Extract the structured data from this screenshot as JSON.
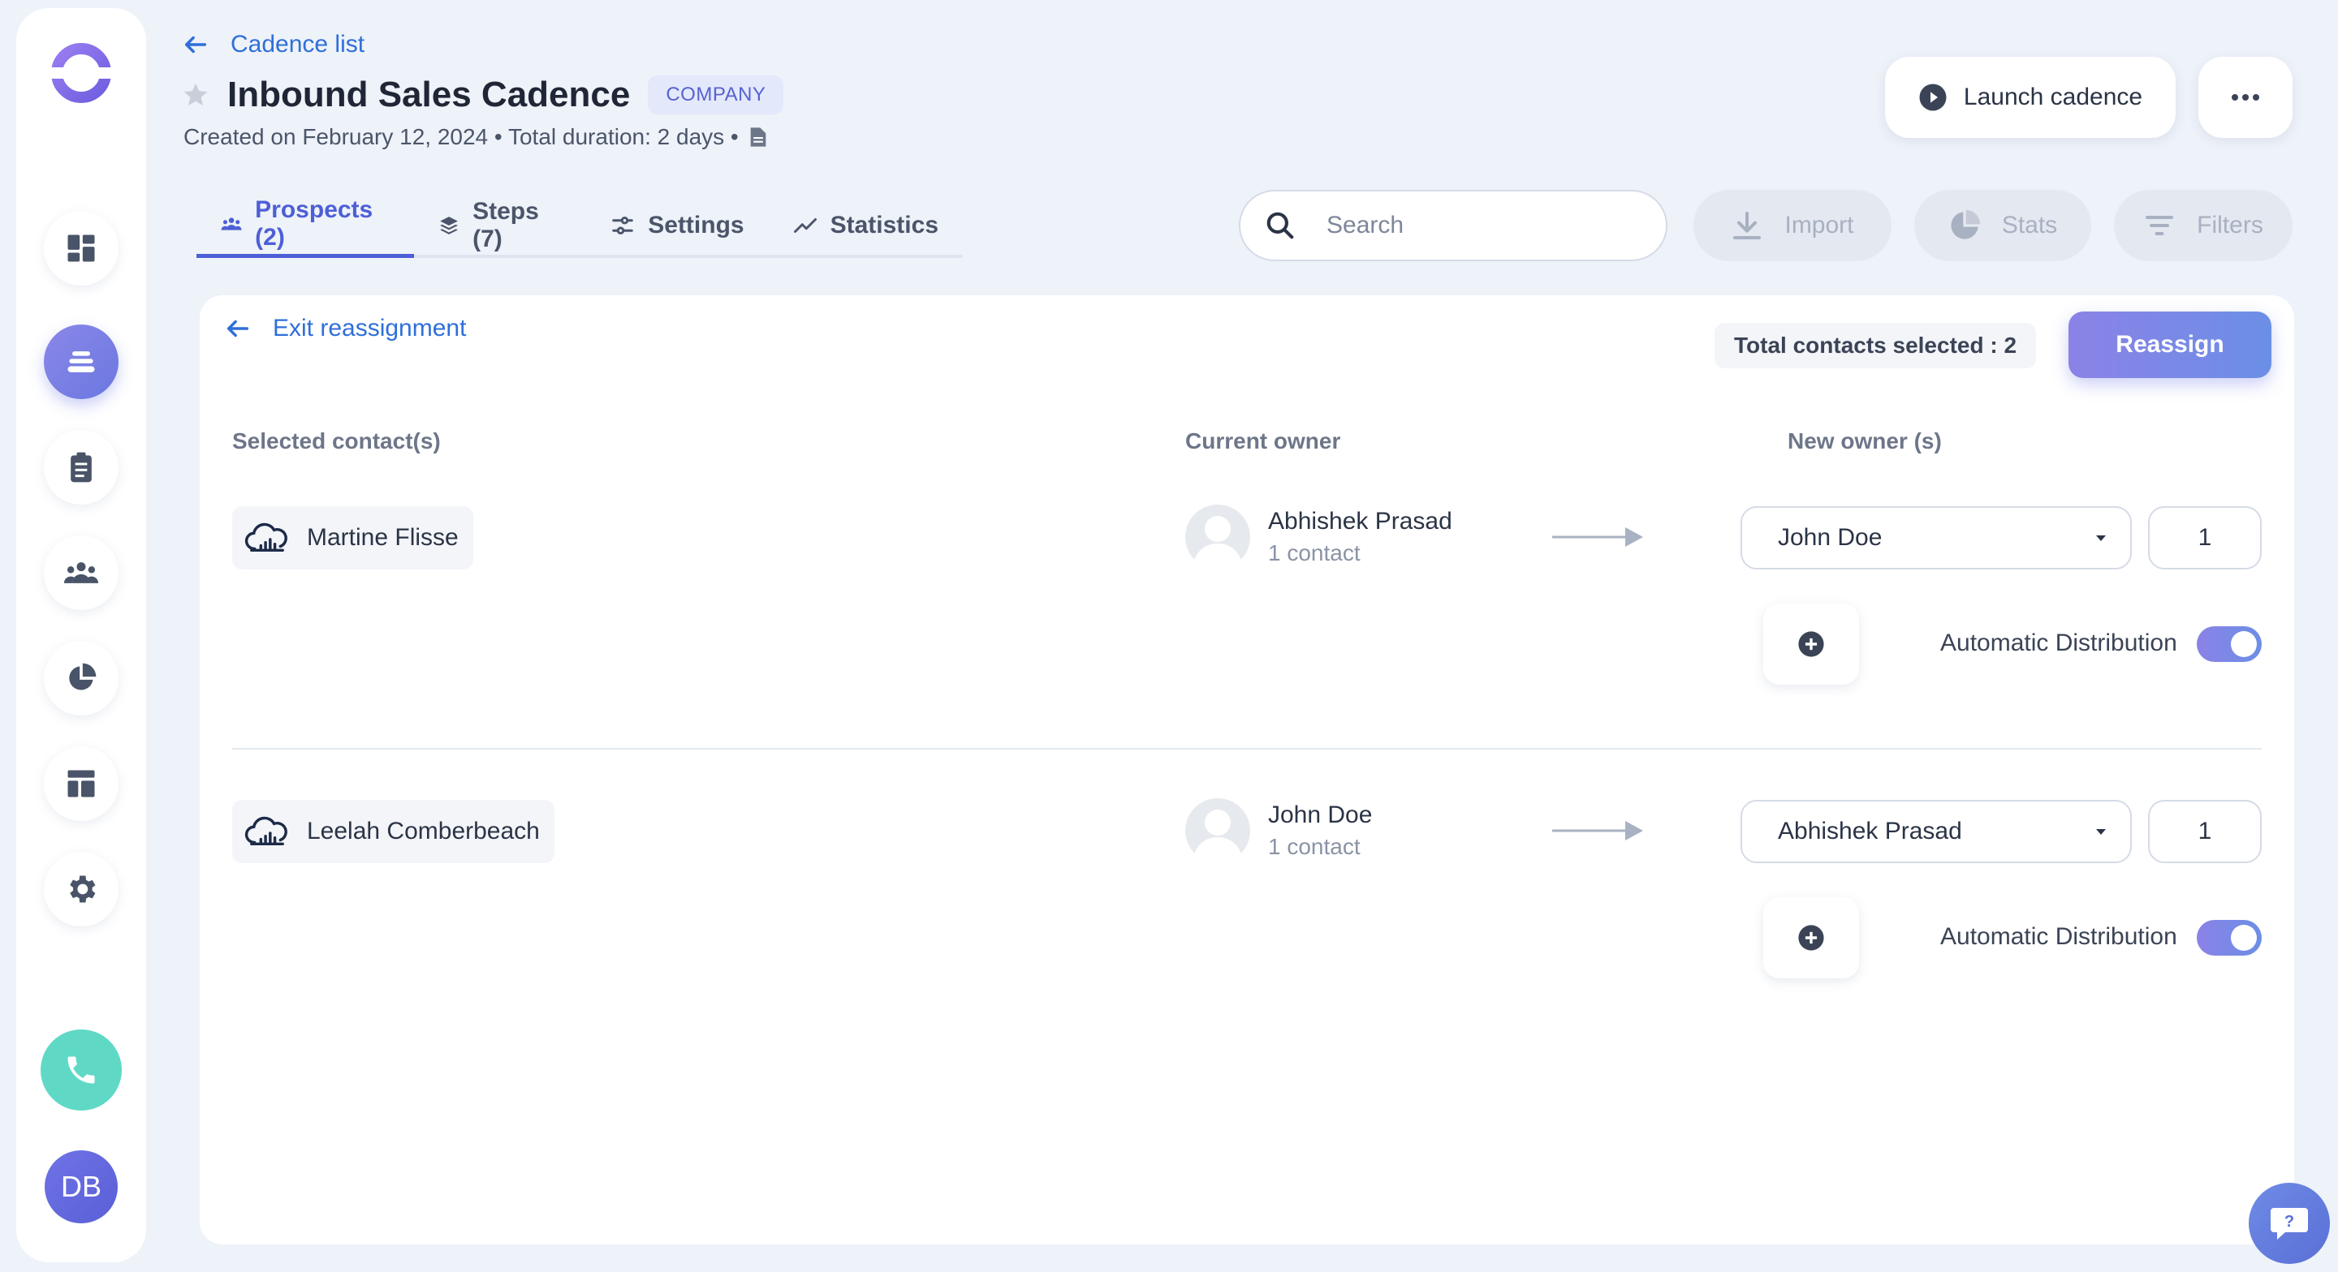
{
  "header": {
    "back_label": "Cadence list",
    "title": "Inbound Sales Cadence",
    "badge": "COMPANY",
    "subtitle": "Created on February 12, 2024 • Total duration: 2 days •",
    "launch_label": "Launch cadence"
  },
  "tabs": [
    {
      "label": "Prospects (2)",
      "icon": "people-icon",
      "active": true
    },
    {
      "label": "Steps (7)",
      "icon": "layers-icon",
      "active": false
    },
    {
      "label": "Settings",
      "icon": "sliders-icon",
      "active": false
    },
    {
      "label": "Statistics",
      "icon": "trend-icon",
      "active": false
    }
  ],
  "toolbar": {
    "search_placeholder": "Search",
    "import_label": "Import",
    "stats_label": "Stats",
    "filters_label": "Filters"
  },
  "reassign": {
    "exit_label": "Exit reassignment",
    "total_selected": "Total contacts selected : 2",
    "reassign_label": "Reassign",
    "col_selected": "Selected contact(s)",
    "col_current": "Current owner",
    "col_new": "New owner (s)",
    "rows": [
      {
        "contact": "Martine Flisse",
        "current_owner": "Abhishek Prasad",
        "current_count": "1 contact",
        "new_owner": "John Doe",
        "quantity": "1",
        "auto_label": "Automatic Distribution",
        "auto_on": true
      },
      {
        "contact": "Leelah Comberbeach",
        "current_owner": "John Doe",
        "current_count": "1 contact",
        "new_owner": "Abhishek Prasad",
        "quantity": "1",
        "auto_label": "Automatic Distribution",
        "auto_on": true
      }
    ]
  },
  "sidebar": {
    "items": [
      "dashboard-icon",
      "cadence-icon",
      "tasks-icon",
      "people-icon",
      "pie-chart-icon",
      "templates-icon",
      "gear-icon"
    ],
    "active_index": 1,
    "user_initials": "DB"
  },
  "colors": {
    "accent": "#4d5fd6",
    "link": "#2f6fd9",
    "background": "#eef2f9",
    "phone": "#5fd9c5"
  }
}
